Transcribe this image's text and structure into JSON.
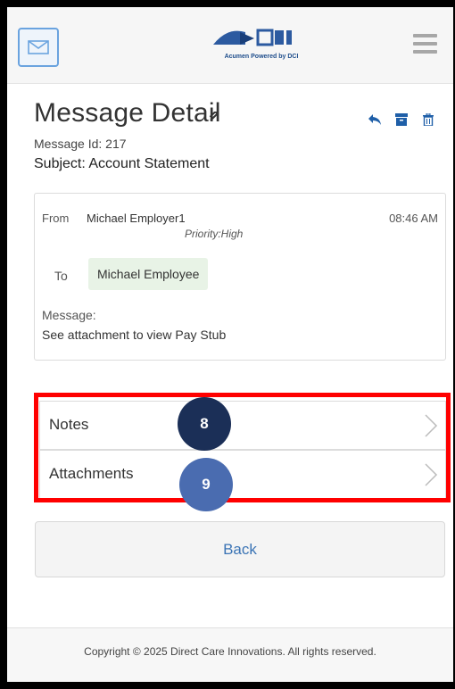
{
  "header": {
    "logo_tagline": "Acumen Powered by DCI",
    "colors": {
      "mail_border": "#6aa3df",
      "logo_blue": "#1f4e8c"
    }
  },
  "detail": {
    "title": "Message Detail",
    "message_id": "Message Id: 217",
    "subject": "Subject: Account Statement"
  },
  "message": {
    "from_label": "From",
    "from_name": "Michael Employer1",
    "time": "08:46 AM",
    "priority": "Priority:High",
    "to_label": "To",
    "to_name": "Michael Employee",
    "message_label": "Message:",
    "message_text": "See attachment to view Pay Stub"
  },
  "list": {
    "items": [
      {
        "label": "Notes",
        "badge": "8",
        "badge_color": "#1b2f57"
      },
      {
        "label": "Attachments",
        "badge": "9",
        "badge_color": "#4a6cb0"
      }
    ],
    "highlight_color": "#ff0000"
  },
  "buttons": {
    "back_label": "Back"
  },
  "footer": {
    "copyright": "Copyright © 2025 Direct Care Innovations. All rights reserved."
  }
}
